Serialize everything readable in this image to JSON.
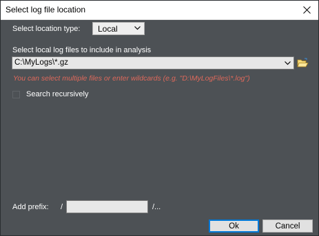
{
  "window": {
    "title": "Select log file location"
  },
  "location_type": {
    "label": "Select location type:",
    "selected": "Local"
  },
  "files": {
    "label": "Select local log files to include in analysis",
    "value": "C:\\MyLogs\\*.gz",
    "hint": "You can select multiple files or enter wildcards (e.g. \"D:\\MyLogFiles\\*.log\")"
  },
  "recursive": {
    "label": "Search recursively",
    "checked": false
  },
  "prefix": {
    "label": "Add prefix:",
    "leading": "/",
    "value": "",
    "trailing": "/..."
  },
  "buttons": {
    "ok": "Ok",
    "cancel": "Cancel"
  },
  "colors": {
    "panel_bg": "#4d5155",
    "hint_text": "#e0695b",
    "focus_border": "#0078d7"
  },
  "icons": {
    "close": "close-icon",
    "dropdown": "chevron-down-icon",
    "browse": "folder-open-icon"
  }
}
